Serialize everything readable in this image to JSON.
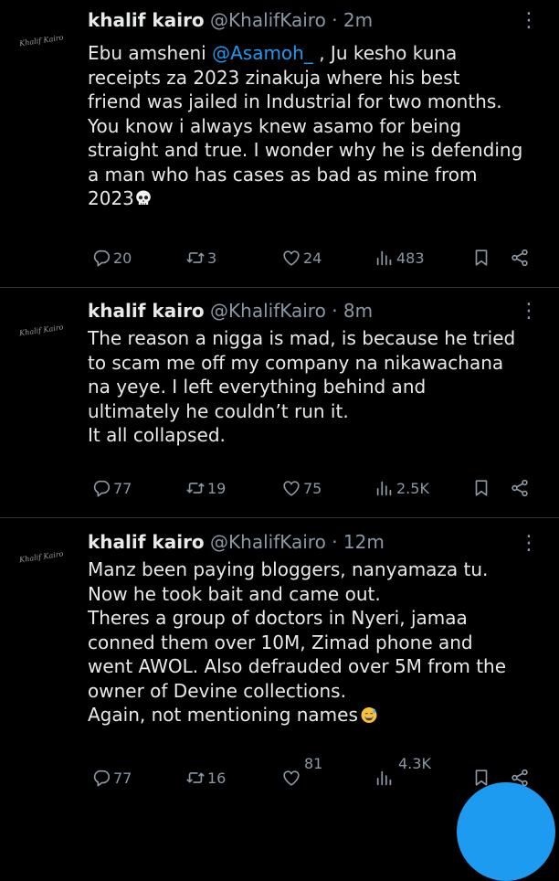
{
  "tweets": [
    {
      "avatar_text": "Khalif Kairo",
      "name": "khalif kairo",
      "handle": "@KhalifKairo",
      "time": "· 2m",
      "lines": [
        {
          "pre": "Ebu amsheni ",
          "mention": "@Asamoh_",
          "post": " , Ju kesho kuna"
        },
        {
          "text": "receipts za 2023 zinakuja where his best"
        },
        {
          "text": "friend was jailed in Industrial for two months."
        },
        {
          "text": "You know i always knew asamo for being"
        },
        {
          "text": "straight and true. I wonder why he is defending"
        },
        {
          "text": "a man who has cases as bad as mine from"
        },
        {
          "text": "2023"
        }
      ],
      "replies": "20",
      "reposts": "3",
      "likes": "24",
      "views": "483"
    },
    {
      "avatar_text": "Khalif Kairo",
      "name": "khalif kairo",
      "handle": "@KhalifKairo",
      "time": "· 8m",
      "lines": [
        {
          "text": "The reason a nigga is mad, is because he tried"
        },
        {
          "text": "to scam me off my company na nikawachana"
        },
        {
          "text": "na yeye.  I left everything behind and"
        },
        {
          "text": "ultimately he couldn’t run it."
        },
        {
          "text": "It all collapsed."
        }
      ],
      "replies": "77",
      "reposts": "19",
      "likes": "75",
      "views": "2.5K"
    },
    {
      "avatar_text": "Khalif Kairo",
      "name": "khalif kairo",
      "handle": "@KhalifKairo",
      "time": "· 12m",
      "lines": [
        {
          "text": "Manz been paying bloggers, nanyamaza tu."
        },
        {
          "text": "Now he took bait and came out."
        },
        {
          "text": "Theres a group of doctors in Nyeri, jamaa"
        },
        {
          "text": "conned them over 10M, Zimad phone and"
        },
        {
          "text": "went AWOL.  Also defrauded over 5M from the"
        },
        {
          "text": "owner of Devine collections."
        },
        {
          "text": "Again, not mentioning names"
        }
      ],
      "replies": "77",
      "reposts": "16",
      "likes": "81",
      "views": "4.3K"
    }
  ],
  "icons": {
    "reply": "reply-icon",
    "repost": "repost-icon",
    "like": "heart-icon",
    "views": "views-icon",
    "bookmark": "bookmark-icon",
    "share": "share-icon",
    "more": "more-icon",
    "compose": "compose-fab"
  },
  "colors": {
    "background": "#000000",
    "text": "#e7e9ea",
    "muted": "#8b98a5",
    "accent": "#1d9bf0",
    "divider": "#2f3336"
  }
}
